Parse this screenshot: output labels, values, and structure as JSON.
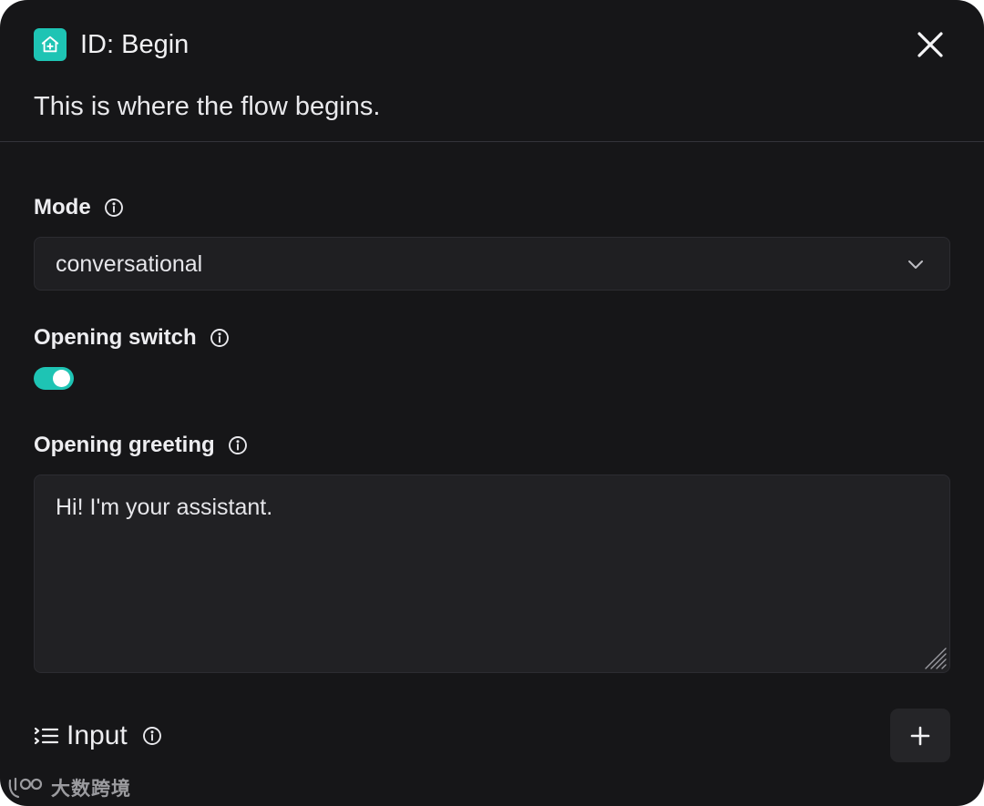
{
  "header": {
    "icon": "home-plus-icon",
    "title": "ID: Begin",
    "description": "This is where the flow begins.",
    "close_icon": "close-icon"
  },
  "form": {
    "mode": {
      "label": "Mode",
      "info_icon": "info-icon",
      "value": "conversational",
      "chevron_icon": "chevron-down-icon"
    },
    "opening_switch": {
      "label": "Opening switch",
      "info_icon": "info-icon",
      "enabled": true
    },
    "opening_greeting": {
      "label": "Opening greeting",
      "info_icon": "info-icon",
      "value": "Hi! I'm your assistant."
    },
    "input": {
      "label": "Input",
      "list_icon": "list-icon",
      "info_icon": "info-icon",
      "add_icon": "plus-icon"
    }
  },
  "watermark": {
    "text": "大数跨境"
  },
  "colors": {
    "accent": "#1ec4b4",
    "background": "#161618",
    "field": "#1f1f22",
    "text": "#ececee"
  }
}
